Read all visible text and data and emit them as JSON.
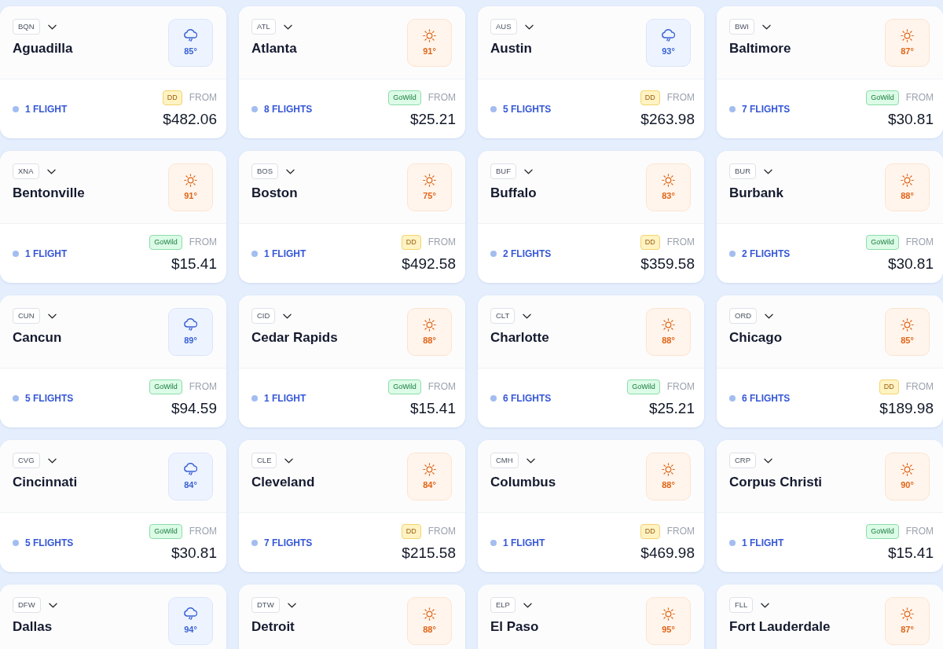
{
  "destinations": [
    {
      "code": "BQN",
      "city": "Aguadilla",
      "weather": {
        "kind": "rain",
        "temp": "85°"
      },
      "flights": "1 FLIGHT",
      "fare": {
        "kind": "dd",
        "label": "DD"
      },
      "from": "FROM",
      "price": "$482.06"
    },
    {
      "code": "ATL",
      "city": "Atlanta",
      "weather": {
        "kind": "sun",
        "temp": "91°"
      },
      "flights": "8 FLIGHTS",
      "fare": {
        "kind": "gowild",
        "label": "GoWild"
      },
      "from": "FROM",
      "price": "$25.21"
    },
    {
      "code": "AUS",
      "city": "Austin",
      "weather": {
        "kind": "rain",
        "temp": "93°"
      },
      "flights": "5 FLIGHTS",
      "fare": {
        "kind": "dd",
        "label": "DD"
      },
      "from": "FROM",
      "price": "$263.98"
    },
    {
      "code": "BWI",
      "city": "Baltimore",
      "weather": {
        "kind": "sun",
        "temp": "87°"
      },
      "flights": "7 FLIGHTS",
      "fare": {
        "kind": "gowild",
        "label": "GoWild"
      },
      "from": "FROM",
      "price": "$30.81"
    },
    {
      "code": "XNA",
      "city": "Bentonville",
      "weather": {
        "kind": "sun",
        "temp": "91°"
      },
      "flights": "1 FLIGHT",
      "fare": {
        "kind": "gowild",
        "label": "GoWild"
      },
      "from": "FROM",
      "price": "$15.41"
    },
    {
      "code": "BOS",
      "city": "Boston",
      "weather": {
        "kind": "sun",
        "temp": "75°"
      },
      "flights": "1 FLIGHT",
      "fare": {
        "kind": "dd",
        "label": "DD"
      },
      "from": "FROM",
      "price": "$492.58"
    },
    {
      "code": "BUF",
      "city": "Buffalo",
      "weather": {
        "kind": "sun",
        "temp": "83°"
      },
      "flights": "2 FLIGHTS",
      "fare": {
        "kind": "dd",
        "label": "DD"
      },
      "from": "FROM",
      "price": "$359.58"
    },
    {
      "code": "BUR",
      "city": "Burbank",
      "weather": {
        "kind": "sun",
        "temp": "88°"
      },
      "flights": "2 FLIGHTS",
      "fare": {
        "kind": "gowild",
        "label": "GoWild"
      },
      "from": "FROM",
      "price": "$30.81"
    },
    {
      "code": "CUN",
      "city": "Cancun",
      "weather": {
        "kind": "rain",
        "temp": "89°"
      },
      "flights": "5 FLIGHTS",
      "fare": {
        "kind": "gowild",
        "label": "GoWild"
      },
      "from": "FROM",
      "price": "$94.59"
    },
    {
      "code": "CID",
      "city": "Cedar Rapids",
      "weather": {
        "kind": "sun",
        "temp": "88°"
      },
      "flights": "1 FLIGHT",
      "fare": {
        "kind": "gowild",
        "label": "GoWild"
      },
      "from": "FROM",
      "price": "$15.41"
    },
    {
      "code": "CLT",
      "city": "Charlotte",
      "weather": {
        "kind": "sun",
        "temp": "88°"
      },
      "flights": "6 FLIGHTS",
      "fare": {
        "kind": "gowild",
        "label": "GoWild"
      },
      "from": "FROM",
      "price": "$25.21"
    },
    {
      "code": "ORD",
      "city": "Chicago",
      "weather": {
        "kind": "sun",
        "temp": "85°"
      },
      "flights": "6 FLIGHTS",
      "fare": {
        "kind": "dd",
        "label": "DD"
      },
      "from": "FROM",
      "price": "$189.98"
    },
    {
      "code": "CVG",
      "city": "Cincinnati",
      "weather": {
        "kind": "rain",
        "temp": "84°"
      },
      "flights": "5 FLIGHTS",
      "fare": {
        "kind": "gowild",
        "label": "GoWild"
      },
      "from": "FROM",
      "price": "$30.81"
    },
    {
      "code": "CLE",
      "city": "Cleveland",
      "weather": {
        "kind": "sun",
        "temp": "84°"
      },
      "flights": "7 FLIGHTS",
      "fare": {
        "kind": "dd",
        "label": "DD"
      },
      "from": "FROM",
      "price": "$215.58"
    },
    {
      "code": "CMH",
      "city": "Columbus",
      "weather": {
        "kind": "sun",
        "temp": "88°"
      },
      "flights": "1 FLIGHT",
      "fare": {
        "kind": "dd",
        "label": "DD"
      },
      "from": "FROM",
      "price": "$469.98"
    },
    {
      "code": "CRP",
      "city": "Corpus Christi",
      "weather": {
        "kind": "sun",
        "temp": "90°"
      },
      "flights": "1 FLIGHT",
      "fare": {
        "kind": "gowild",
        "label": "GoWild"
      },
      "from": "FROM",
      "price": "$15.41"
    },
    {
      "code": "DFW",
      "city": "Dallas",
      "weather": {
        "kind": "rain",
        "temp": "94°"
      }
    },
    {
      "code": "DTW",
      "city": "Detroit",
      "weather": {
        "kind": "sun",
        "temp": "88°"
      }
    },
    {
      "code": "ELP",
      "city": "El Paso",
      "weather": {
        "kind": "sun",
        "temp": "95°"
      }
    },
    {
      "code": "FLL",
      "city": "Fort Lauderdale",
      "weather": {
        "kind": "sun",
        "temp": "87°"
      }
    }
  ]
}
